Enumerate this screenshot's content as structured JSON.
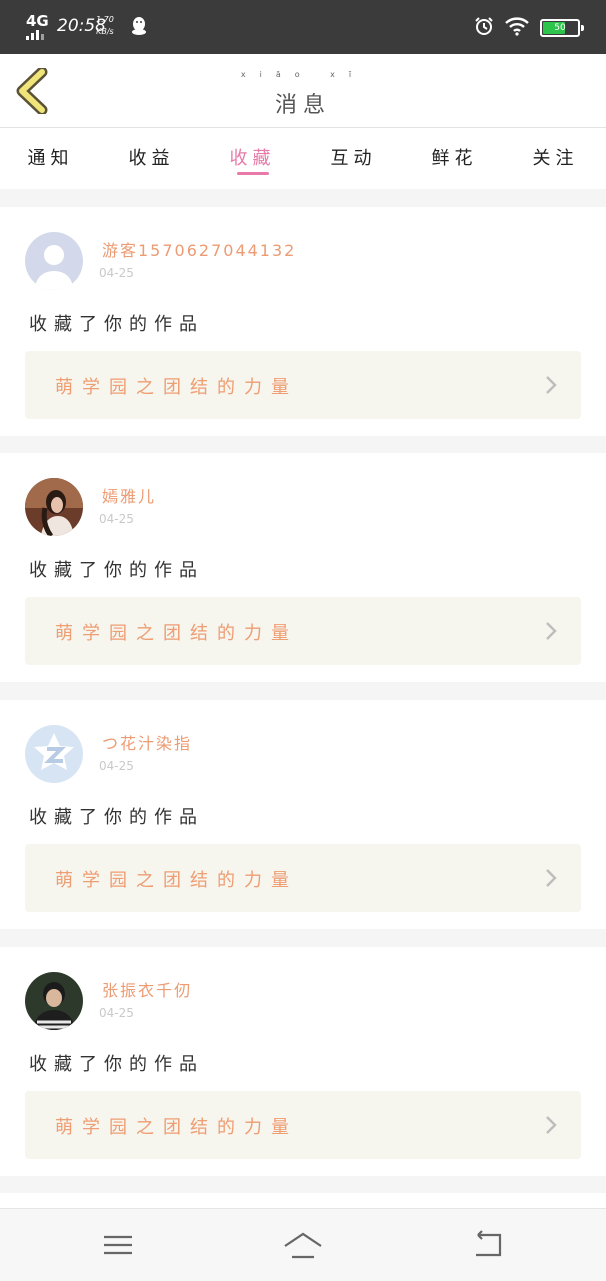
{
  "status_bar": {
    "network": "4G",
    "time": "20:58",
    "speed_value": "1.70",
    "speed_unit": "KB/s",
    "battery_level": "50",
    "icons": [
      "qq-icon",
      "alarm-icon",
      "wifi-icon",
      "battery-icon"
    ]
  },
  "header": {
    "title": "消息",
    "title_pinyin": "xiāo xī",
    "back_icon": "chevron-left-icon"
  },
  "tabs": [
    {
      "label": "通知",
      "active": false
    },
    {
      "label": "收益",
      "active": false
    },
    {
      "label": "收藏",
      "active": true
    },
    {
      "label": "互动",
      "active": false
    },
    {
      "label": "鲜花",
      "active": false
    },
    {
      "label": "关注",
      "active": false
    }
  ],
  "notifications": [
    {
      "username": "游客15706270441​32",
      "date": "04-25",
      "action": "收藏了你的作品",
      "work_title": "萌学园之团结的力量",
      "avatar": "default-avatar"
    },
    {
      "username": "嫣雅儿",
      "date": "04-25",
      "action": "收藏了你的作品",
      "work_title": "萌学园之团结的力量",
      "avatar": "photo-avatar"
    },
    {
      "username": "つ花汁染指",
      "date": "04-25",
      "action": "收藏了你的作品",
      "work_title": "萌学园之团结的力量",
      "avatar": "qzone-avatar"
    },
    {
      "username": "张振衣千仞",
      "date": "04-25",
      "action": "收藏了你的作品",
      "work_title": "萌学园之团结的力量",
      "avatar": "photo-avatar"
    }
  ],
  "colors": {
    "accent_pink": "#e77aa8",
    "name_orange": "#ec9b72",
    "status_bar": "#3b3b3b",
    "back_yellow": "#f1e479"
  }
}
